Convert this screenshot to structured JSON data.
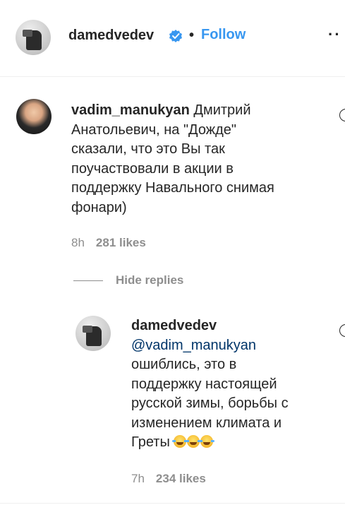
{
  "header": {
    "username": "damedvedev",
    "separator": "•",
    "follow_label": "Follow",
    "more_label": "··",
    "verified_color": "#3897f0"
  },
  "comment1": {
    "username": "vadim_manukyan",
    "text": "Дмитрий\nАнатольевич, на \"Дожде\"\nсказали, что это Вы так\nпоучаствовали в акции в\nподдержку Навального снимая\nфонари)",
    "time": "8h",
    "likes": "281 likes"
  },
  "replies": {
    "hide_label": "Hide replies"
  },
  "comment2": {
    "username": "damedvedev",
    "mention": "@vadim_manukyan",
    "text": "ошиблись, это в\nподдержку настоящей\nрусской зимы, борьбы с\nизменением климата и\nГреты ",
    "emoji": [
      "face-with-tears-of-joy",
      "face-with-tears-of-joy",
      "face-with-tears-of-joy"
    ],
    "time": "7h",
    "likes": "234 likes"
  },
  "colors": {
    "text": "#262626",
    "muted": "#8e8e8e",
    "link": "#3897f0",
    "mention": "#003569"
  }
}
